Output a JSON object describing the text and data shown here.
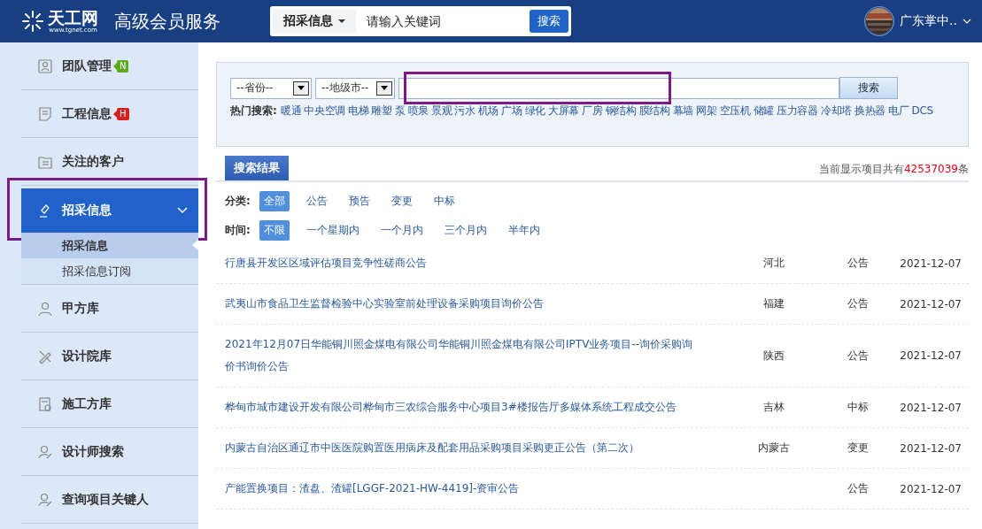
{
  "header": {
    "logo_text": "天工网",
    "logo_url": "www.tgnet.com",
    "service_title": "高级会员服务",
    "search": {
      "category": "招采信息",
      "placeholder": "请输入关键词",
      "button": "搜索"
    },
    "user": {
      "name": "广东掌中.."
    }
  },
  "sidebar": {
    "items": [
      {
        "label": "团队管理",
        "badge": {
          "text": "N",
          "color": "#5aaa1e"
        },
        "selected": false,
        "highlighted": false
      },
      {
        "label": "工程信息",
        "badge": {
          "text": "H",
          "color": "#d42020"
        },
        "selected": false,
        "highlighted": false
      },
      {
        "label": "关注的客户",
        "selected": false,
        "highlighted": false
      },
      {
        "label": "招采信息",
        "selected": true,
        "expanded": true,
        "highlighted": true,
        "children": [
          {
            "label": "招采信息",
            "selected": true
          },
          {
            "label": "招采信息订阅",
            "selected": false
          }
        ]
      },
      {
        "label": "甲方库",
        "selected": false,
        "highlighted": false
      },
      {
        "label": "设计院库",
        "selected": false,
        "highlighted": false
      },
      {
        "label": "施工方库",
        "selected": false,
        "highlighted": false
      },
      {
        "label": "设计师搜索",
        "selected": false,
        "highlighted": false
      },
      {
        "label": "查询项目关键人",
        "selected": false,
        "highlighted": false
      }
    ]
  },
  "search_panel": {
    "province": "--省份--",
    "city": "--地级市--",
    "keyword_highlighted": true,
    "button": "搜索",
    "hot_label": "热门搜索:",
    "hot_terms": [
      "暖通",
      "中央空调",
      "电梯",
      "雕塑",
      "泵",
      "喷泉",
      "景观",
      "污水",
      "机场",
      "广场",
      "绿化",
      "大屏幕",
      "厂房",
      "钢结构",
      "膜结构",
      "幕墙",
      "网架",
      "空压机",
      "储罐",
      "压力容器",
      "冷却塔",
      "换热器",
      "电厂",
      "DCS"
    ]
  },
  "results": {
    "tab": "搜索结果",
    "count_prefix": "当前显示项目共有",
    "count": "42537039",
    "count_suffix": "条",
    "filters": [
      {
        "label": "分类:",
        "options": [
          {
            "label": "全部",
            "selected": true
          },
          {
            "label": "公告",
            "selected": false
          },
          {
            "label": "预告",
            "selected": false
          },
          {
            "label": "变更",
            "selected": false
          },
          {
            "label": "中标",
            "selected": false
          }
        ]
      },
      {
        "label": "时间:",
        "options": [
          {
            "label": "不限",
            "selected": true
          },
          {
            "label": "一个星期内",
            "selected": false
          },
          {
            "label": "一个月内",
            "selected": false
          },
          {
            "label": "三个月内",
            "selected": false
          },
          {
            "label": "半年内",
            "selected": false
          }
        ]
      }
    ],
    "rows": [
      {
        "title": "行唐县开发区区域评估项目竞争性磋商公告",
        "province": "河北",
        "type": "公告",
        "date": "2021-12-07"
      },
      {
        "title": "武夷山市食品卫生监督检验中心实验室前处理设备采购项目询价公告",
        "province": "福建",
        "type": "公告",
        "date": "2021-12-07"
      },
      {
        "title": "2021年12月07日华能铜川照金煤电有限公司华能铜川照金煤电有限公司IPTV业务项目--询价采购询价书询价公告",
        "province": "陕西",
        "type": "公告",
        "date": "2021-12-07"
      },
      {
        "title": "桦甸市城市建设开发有限公司桦甸市三农综合服务中心项目3#楼报告厅多媒体系统工程成交公告",
        "province": "吉林",
        "type": "中标",
        "date": "2021-12-07"
      },
      {
        "title": "内蒙古自治区通辽市中医医院购置医用病床及配套用品采购项目采购更正公告（第二次）",
        "province": "内蒙古",
        "type": "变更",
        "date": "2021-12-07"
      },
      {
        "title": "产能置换项目：渣盘、渣罐[LGGF-2021-HW-4419]-资审公告",
        "province": "",
        "type": "公告",
        "date": "2021-12-07"
      }
    ]
  }
}
